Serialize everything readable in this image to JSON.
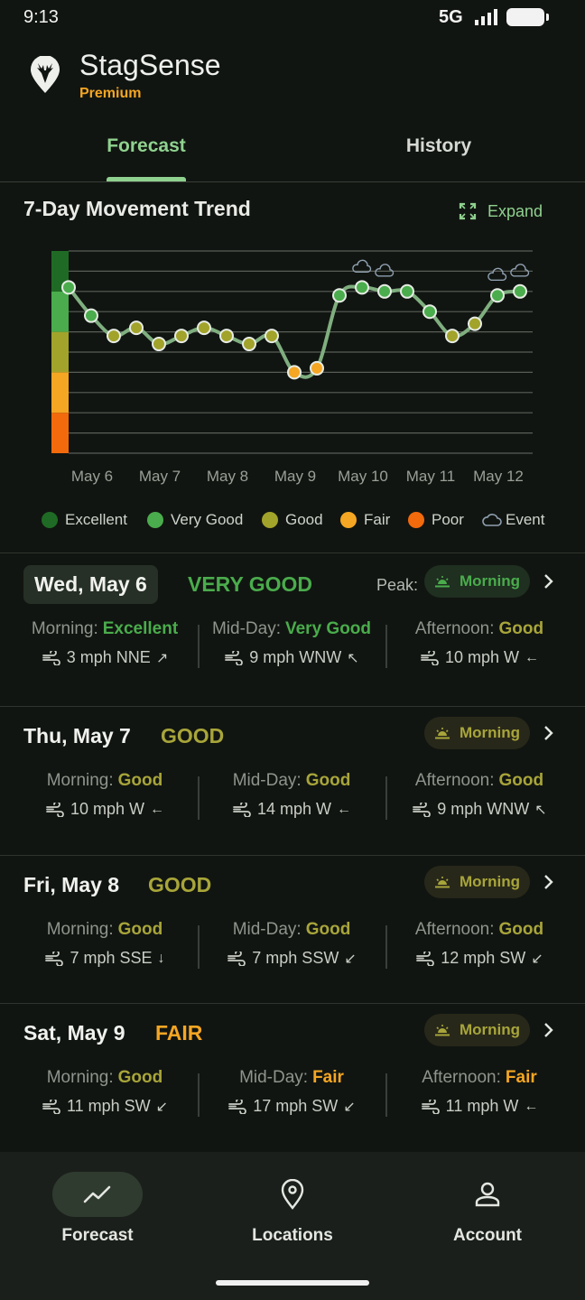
{
  "status": {
    "time": "9:13",
    "network": "5G"
  },
  "app": {
    "title": "StagSense",
    "plan": "Premium"
  },
  "tabs": [
    {
      "label": "Forecast",
      "active": true
    },
    {
      "label": "History",
      "active": false
    }
  ],
  "trend": {
    "title": "7-Day Movement Trend",
    "expand_label": "Expand"
  },
  "colors": {
    "excellent": "#1f6b25",
    "very_good": "#4aac4c",
    "good": "#a2a32a",
    "fair": "#f5a623",
    "poor": "#f26a0c",
    "accent": "#8fd18f"
  },
  "chart_data": {
    "type": "line",
    "x_labels": [
      "May 6",
      "May 7",
      "May 8",
      "May 9",
      "May 10",
      "May 11",
      "May 12"
    ],
    "legend": [
      "Excellent",
      "Very Good",
      "Good",
      "Fair",
      "Poor",
      "Event"
    ],
    "series": [
      {
        "values": [
          4.1,
          3.4,
          2.9,
          3.1,
          2.7,
          2.9,
          3.1,
          2.9,
          2.7,
          2.9,
          2.0,
          2.1,
          3.9,
          4.1,
          4.0,
          4.0,
          3.5,
          2.9,
          3.2,
          3.9,
          4.0
        ],
        "ratings": [
          "very_good",
          "very_good",
          "good",
          "good",
          "good",
          "good",
          "good",
          "good",
          "good",
          "good",
          "fair",
          "fair",
          "very_good",
          "very_good",
          "very_good",
          "very_good",
          "very_good",
          "good",
          "good",
          "very_good",
          "very_good"
        ]
      }
    ],
    "events_at_points": [
      13,
      14,
      19,
      20
    ],
    "ylim": [
      0,
      5
    ],
    "grid": true
  },
  "days": [
    {
      "date": "Wed, May 6",
      "rating": "VERY GOOD",
      "rating_color": "#4aac4c",
      "peak_label": "Peak:",
      "peak": "Morning",
      "selected": true,
      "periods": [
        {
          "label": "Morning:",
          "value": "Excellent",
          "value_color": "#4aac4c",
          "wind": "3 mph NNE",
          "arrow": "↗"
        },
        {
          "label": "Mid-Day:",
          "value": "Very Good",
          "value_color": "#4aac4c",
          "wind": "9 mph WNW",
          "arrow": "↖"
        },
        {
          "label": "Afternoon:",
          "value": "Good",
          "value_color": "#a8a53a",
          "wind": "10 mph W",
          "arrow": "←"
        }
      ]
    },
    {
      "date": "Thu, May 7",
      "rating": "GOOD",
      "rating_color": "#a8a53a",
      "peak": "Morning",
      "periods": [
        {
          "label": "Morning:",
          "value": "Good",
          "value_color": "#a8a53a",
          "wind": "10 mph W",
          "arrow": "←"
        },
        {
          "label": "Mid-Day:",
          "value": "Good",
          "value_color": "#a8a53a",
          "wind": "14 mph W",
          "arrow": "←"
        },
        {
          "label": "Afternoon:",
          "value": "Good",
          "value_color": "#a8a53a",
          "wind": "9 mph WNW",
          "arrow": "↖"
        }
      ]
    },
    {
      "date": "Fri, May 8",
      "rating": "GOOD",
      "rating_color": "#a8a53a",
      "peak": "Morning",
      "periods": [
        {
          "label": "Morning:",
          "value": "Good",
          "value_color": "#a8a53a",
          "wind": "7 mph SSE",
          "arrow": "↓"
        },
        {
          "label": "Mid-Day:",
          "value": "Good",
          "value_color": "#a8a53a",
          "wind": "7 mph SSW",
          "arrow": "↙"
        },
        {
          "label": "Afternoon:",
          "value": "Good",
          "value_color": "#a8a53a",
          "wind": "12 mph SW",
          "arrow": "↙"
        }
      ]
    },
    {
      "date": "Sat, May 9",
      "rating": "FAIR",
      "rating_color": "#f5a623",
      "peak": "Morning",
      "periods": [
        {
          "label": "Morning:",
          "value": "Good",
          "value_color": "#a8a53a",
          "wind": "11 mph SW",
          "arrow": "↙"
        },
        {
          "label": "Mid-Day:",
          "value": "Fair",
          "value_color": "#f5a623",
          "wind": "17 mph SW",
          "arrow": "↙"
        },
        {
          "label": "Afternoon:",
          "value": "Fair",
          "value_color": "#f5a623",
          "wind": "11 mph W",
          "arrow": "←"
        }
      ]
    }
  ],
  "nav": [
    {
      "label": "Forecast",
      "icon": "trend-icon",
      "active": true
    },
    {
      "label": "Locations",
      "icon": "location-pin-icon",
      "active": false
    },
    {
      "label": "Account",
      "icon": "person-icon",
      "active": false
    }
  ]
}
